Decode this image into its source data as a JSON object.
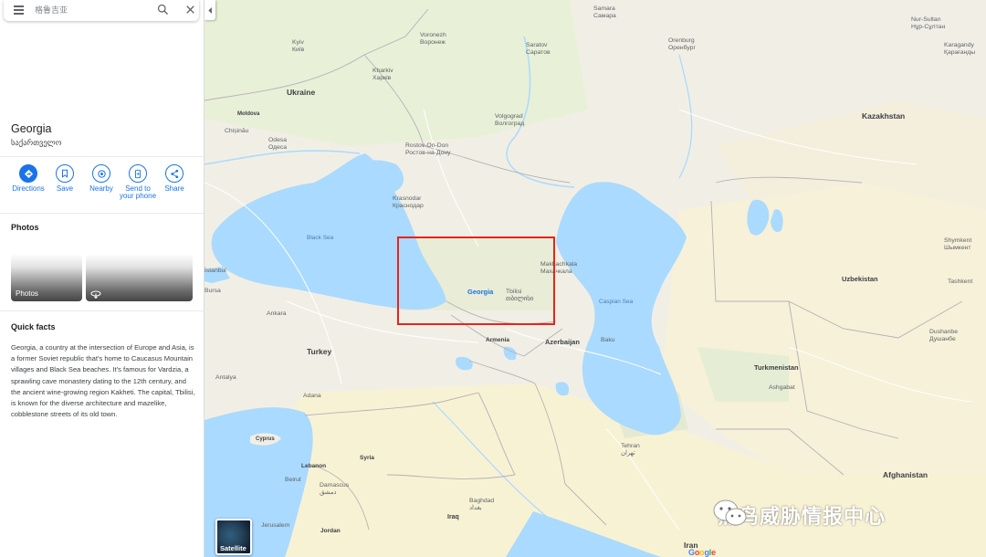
{
  "search": {
    "placeholder": "格鲁吉亚",
    "value": ""
  },
  "place": {
    "title": "Georgia",
    "native_name": "საქართველო"
  },
  "actions": [
    {
      "label": "Directions",
      "icon": "directions-icon"
    },
    {
      "label": "Save",
      "icon": "bookmark-icon"
    },
    {
      "label": "Nearby",
      "icon": "nearby-icon"
    },
    {
      "label": "Send to your phone",
      "icon": "send-to-phone-icon"
    },
    {
      "label": "Share",
      "icon": "share-icon"
    }
  ],
  "photos": {
    "heading": "Photos",
    "tile_label": "Photos"
  },
  "quick_facts": {
    "heading": "Quick facts",
    "text": "Georgia, a country at the intersection of Europe and Asia, is a former Soviet republic that's home to Caucasus Mountain villages and Black Sea beaches. It's famous for Vardzia, a sprawling cave monastery dating to the 12th century, and the ancient wine-growing region Kakheti. The capital, Tbilisi, is known for the diverse architecture and mazelike, cobblestone streets of its old town."
  },
  "map": {
    "countries": {
      "ukraine": "Ukraine",
      "kazakhstan": "Kazakhstan",
      "turkey": "Turkey",
      "uzbekistan": "Uzbekistan",
      "turkmenistan": "Turkmenistan",
      "afghanistan": "Afghanistan",
      "georgia": "Georgia",
      "azerbaijan": "Azerbaijan",
      "armenia": "Armenia",
      "iran": "Iran",
      "iraq": "Iraq",
      "syria": "Syria",
      "lebanon": "Lebanon",
      "jordan": "Jordan",
      "cyprus": "Cyprus",
      "moldova": "Moldova"
    },
    "seas": {
      "black_sea": "Black Sea",
      "caspian_sea": "Caspian Sea"
    },
    "cities": {
      "samara": "Samara\nСамара",
      "nur_sultan": "Nur-Sultan\nНұр-Сұлтан",
      "kyiv": "Kyiv\nКиїв",
      "voronezh": "Voronezh\nВоронеж",
      "saratov": "Saratov\nСаратов",
      "orenburg": "Orenburg\nОренбург",
      "karagandy": "Karagandy\nҚарағанды",
      "kharkiv": "Kharkiv\nХарків",
      "volgograd": "Volgograd\nВолгоград",
      "chisinau": "Chișinău",
      "odesa": "Odesa\nОдеса",
      "rostov": "Rostov-On-Don\nРостов-на-Дону",
      "krasnodar": "Krasnodar\nКраснодар",
      "makhachkala": "Makhachkala\nМахачкала",
      "shymkent": "Shymkent\nШымкент",
      "istanbul": "İstanbul",
      "bursa": "Bursa",
      "tbilisi": "Tbilisi\nთბილისი",
      "tashkent": "Tashkent",
      "ankara": "Ankara",
      "baku": "Baku",
      "dushanbe": "Dushanbe\nДушанбе",
      "antalya": "Antalya",
      "ashgabat": "Ashgabat",
      "adana": "Adana",
      "tehran": "Tehran\nتهران",
      "beirut": "Beirut",
      "damascus": "Damascus\nدمشق",
      "baghdad": "Baghdad\nبغداد",
      "jerusalem": "Jerusalem"
    },
    "satellite_label": "Satellite",
    "google_logo": "Google"
  },
  "watermark": {
    "text": "黑鸟威胁情报中心"
  },
  "colors": {
    "accent": "#1a73e8",
    "water": "#aadaff",
    "land": "#f1efe5",
    "desert": "#f8f3d6",
    "green": "#d6e8c4",
    "highlight": "#e8241b"
  }
}
